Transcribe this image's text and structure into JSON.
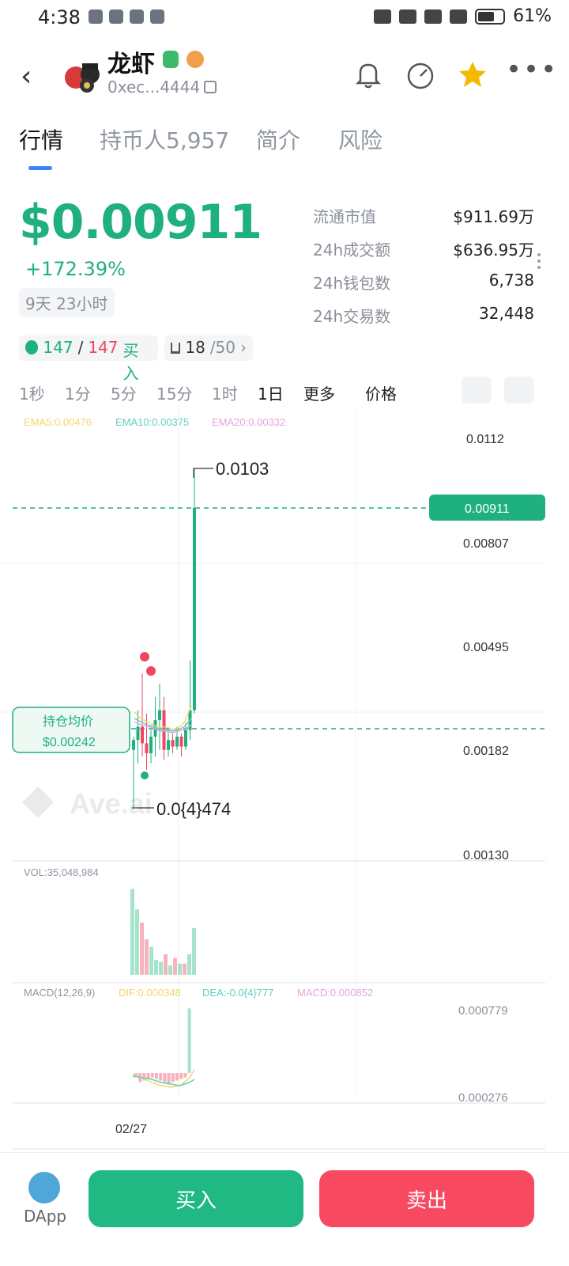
{
  "status": {
    "time": "4:38",
    "battery": "61%",
    "network": "4G"
  },
  "header": {
    "name": "龙虾",
    "address": "0xec...4444",
    "icons": [
      "back-icon",
      "bell-icon",
      "gauge-icon",
      "star-icon",
      "more-icon",
      "copy-icon"
    ]
  },
  "tabs": [
    {
      "label": "行情"
    },
    {
      "label": "持币人5,957"
    },
    {
      "label": "简介"
    },
    {
      "label": "风险"
    }
  ],
  "market": {
    "price": "$0.00911",
    "change": "+172.39%",
    "age": "9天 23小时",
    "stats": [
      {
        "label": "流通市值",
        "value": "$911.69万"
      },
      {
        "label": "24h成交额",
        "value": "$636.95万"
      },
      {
        "label": "24h钱包数",
        "value": "6,738"
      },
      {
        "label": "24h交易数",
        "value": "32,448"
      }
    ]
  },
  "pills": {
    "a": "147",
    "slash": "/",
    "b": "147",
    "buy": "买入",
    "rank": "18",
    "rank_total": "/50",
    "arrow": "›"
  },
  "timeframes": [
    "1秒",
    "1分",
    "5分",
    "15分",
    "1时",
    "1日"
  ],
  "more_label": "更多",
  "price_label": "价格",
  "chart_data": {
    "type": "candlestick",
    "x_label": "02/27",
    "price_ticks": [
      "0.0112",
      "0.00807",
      "0.00495",
      "0.00182",
      "0.00130"
    ],
    "current_price": "0.00911",
    "high_label": "0.0103",
    "low_label": "0.0{4}474",
    "avg_cost_label": "持仓均价",
    "avg_cost_value": "$0.00242",
    "ema": {
      "ema5": "EMA5:0.00476",
      "ema10": "EMA10:0.00375",
      "ema20": "EMA20:0.00332"
    },
    "vol_label": "VOL:35,048,984",
    "macd": {
      "label": "MACD(12,26,9)",
      "dif": "DIF:0.000348",
      "dea": "DEA:-0.0{4}777",
      "macd": "MACD:0.000852",
      "ticks": [
        "0.000779",
        "0.000276"
      ]
    },
    "watermark": "Ave.ai",
    "colors": {
      "up": "#1fb07f",
      "down": "#f0465f",
      "ema5": "#f5d56b",
      "ema10": "#60d0c0",
      "ema20": "#e6a3e0"
    },
    "candles": [
      {
        "o": 0.0018,
        "h": 0.0022,
        "l": 5e-05,
        "c": 0.0021
      },
      {
        "o": 0.0021,
        "h": 0.003,
        "l": 0.0014,
        "c": 0.0025
      },
      {
        "o": 0.0025,
        "h": 0.0041,
        "l": 0.0016,
        "c": 0.002
      },
      {
        "o": 0.002,
        "h": 0.0029,
        "l": 0.0012,
        "c": 0.0017
      },
      {
        "o": 0.0017,
        "h": 0.0024,
        "l": 0.0014,
        "c": 0.0022
      },
      {
        "o": 0.0022,
        "h": 0.0034,
        "l": 0.0016,
        "c": 0.0027
      },
      {
        "o": 0.0027,
        "h": 0.0038,
        "l": 0.0018,
        "c": 0.003
      },
      {
        "o": 0.003,
        "h": 0.0034,
        "l": 0.0015,
        "c": 0.0018
      },
      {
        "o": 0.0018,
        "h": 0.0024,
        "l": 0.0016,
        "c": 0.0021
      },
      {
        "o": 0.0021,
        "h": 0.0023,
        "l": 0.0017,
        "c": 0.0019
      },
      {
        "o": 0.0019,
        "h": 0.0025,
        "l": 0.0018,
        "c": 0.0022
      },
      {
        "o": 0.0022,
        "h": 0.0023,
        "l": 0.0016,
        "c": 0.0019
      },
      {
        "o": 0.0019,
        "h": 0.0026,
        "l": 0.0018,
        "c": 0.0024
      },
      {
        "o": 0.0024,
        "h": 0.0045,
        "l": 0.0021,
        "c": 0.003
      },
      {
        "o": 0.003,
        "h": 0.0103,
        "l": 0.0029,
        "c": 0.00911
      }
    ],
    "volumes": [
      0.92,
      0.7,
      0.56,
      0.38,
      0.3,
      0.16,
      0.14,
      0.22,
      0.1,
      0.18,
      0.12,
      0.12,
      0.22,
      0.5
    ],
    "macd_bars": [
      -0.05,
      -0.12,
      -0.1,
      -0.08,
      -0.06,
      -0.08,
      -0.1,
      -0.12,
      -0.14,
      -0.12,
      -0.1,
      -0.08,
      -0.06,
      0.85
    ]
  },
  "actions": {
    "dapp": "DApp",
    "buy": "买入",
    "sell": "卖出"
  }
}
